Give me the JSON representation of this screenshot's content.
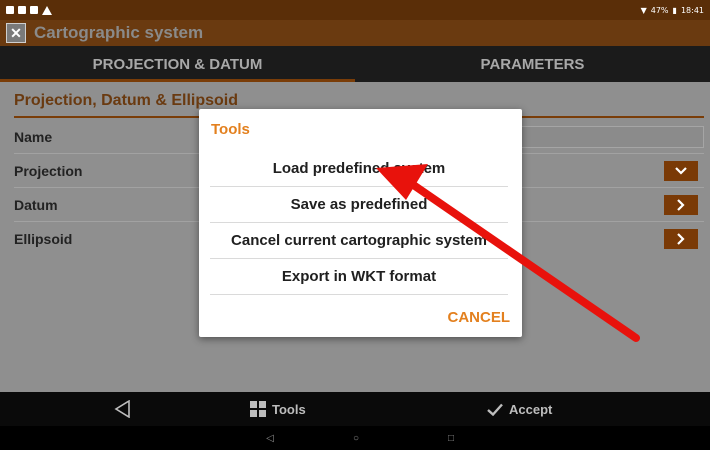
{
  "status_bar": {
    "battery": "47%",
    "time": "18:41"
  },
  "app_bar": {
    "title": "Cartographic system",
    "icon": "app-logo-icon"
  },
  "tabs": [
    {
      "label": "PROJECTION & DATUM",
      "active": true
    },
    {
      "label": "PARAMETERS",
      "active": false
    }
  ],
  "section": {
    "title": "Projection, Datum & Ellipsoid",
    "fields": [
      {
        "label": "Name",
        "value": "",
        "action": ""
      },
      {
        "label": "Projection",
        "value": "",
        "action": "chevron-down-icon"
      },
      {
        "label": "Datum",
        "value": "",
        "action": "chevron-right-icon"
      },
      {
        "label": "Ellipsoid",
        "value": "",
        "action": "chevron-right-icon"
      }
    ]
  },
  "dialog": {
    "title": "Tools",
    "items": [
      "Load predefined system",
      "Save as predefined",
      "Cancel current cartographic system",
      "Export in WKT format"
    ],
    "cancel_label": "CANCEL"
  },
  "bottom_bar": {
    "tools_label": "Tools",
    "accept_label": "Accept"
  },
  "colors": {
    "accent": "#e3801e",
    "app_bar": "#6a3a10",
    "annotation_arrow": "#e8120c"
  }
}
